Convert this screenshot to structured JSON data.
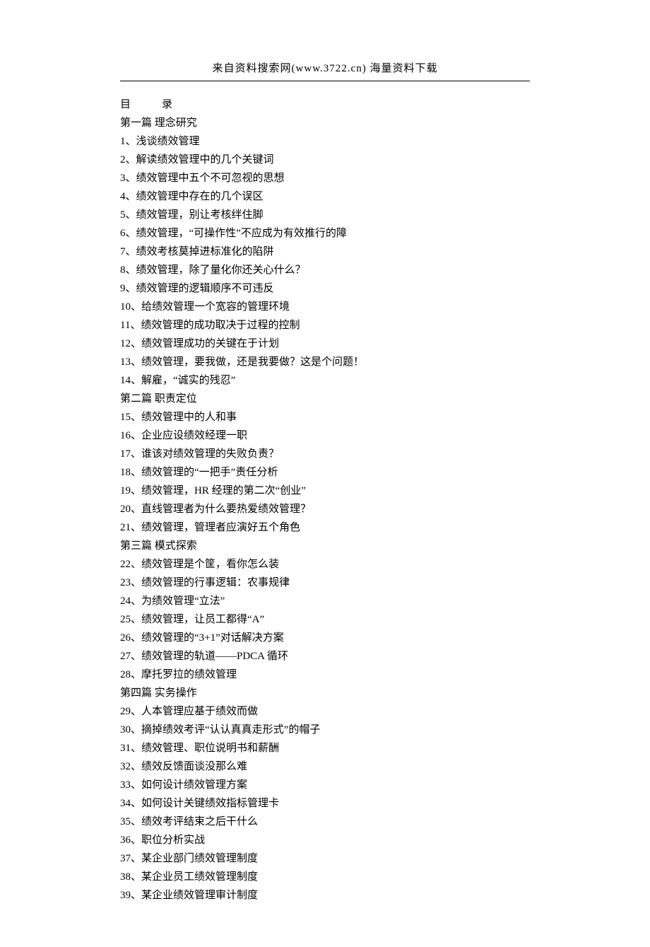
{
  "header": {
    "text": "来自资料搜索网(www.3722.cn) 海量资料下载"
  },
  "toc": {
    "title_part1": "目",
    "title_part2": "录",
    "lines": [
      "第一篇 理念研究",
      "1、浅谈绩效管理",
      "2、解读绩效管理中的几个关键词",
      "3、绩效管理中五个不可忽视的思想",
      "4、绩效管理中存在的几个误区",
      "5、绩效管理，别让考核绊住脚",
      "6、绩效管理，“可操作性”不应成为有效推行的障",
      "7、绩效考核莫掉进标准化的陷阱",
      "8、绩效管理，除了量化你还关心什么？",
      "9、绩效管理的逻辑顺序不可违反",
      "10、给绩效管理一个宽容的管理环境",
      "11、绩效管理的成功取决于过程的控制",
      "12、绩效管理成功的关键在于计划",
      "13、绩效管理，要我做，还是我要做？这是个问题！",
      "14、解雇，“诚实的残忍”",
      "第二篇 职责定位",
      "15、绩效管理中的人和事",
      "16、企业应设绩效经理一职",
      "17、谁该对绩效管理的失败负责？",
      "18、绩效管理的“一把手”责任分析",
      "19、绩效管理，HR 经理的第二次“创业”",
      "20、直线管理者为什么要热爱绩效管理？",
      "21、绩效管理，管理者应演好五个角色",
      "第三篇 模式探索",
      "22、绩效管理是个筐，看你怎么装",
      "23、绩效管理的行事逻辑：农事规律",
      "24、为绩效管理“立法”",
      "25、绩效管理，让员工都得“A”",
      "26、绩效管理的“3+1”对话解决方案",
      "27、绩效管理的轨道——PDCA 循环",
      "28、摩托罗拉的绩效管理",
      "第四篇 实务操作",
      "29、人本管理应基于绩效而做",
      "30、摘掉绩效考评“认认真真走形式”的帽子",
      "31、绩效管理、职位说明书和薪酬",
      "32、绩效反馈面谈没那么难",
      "33、如何设计绩效管理方案",
      "34、如何设计关键绩效指标管理卡",
      "35、绩效考评结束之后干什么",
      "36、职位分析实战",
      "37、某企业部门绩效管理制度",
      "38、某企业员工绩效管理制度",
      "39、某企业绩效管理审计制度"
    ]
  }
}
